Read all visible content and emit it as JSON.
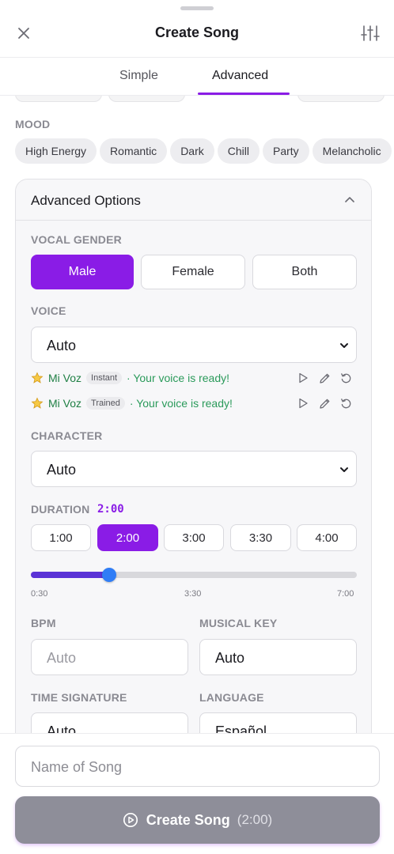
{
  "header": {
    "title": "Create Song"
  },
  "tabs": [
    {
      "label": "Simple",
      "active": false
    },
    {
      "label": "Advanced",
      "active": true
    }
  ],
  "mood": {
    "label": "MOOD",
    "chips": [
      "High Energy",
      "Romantic",
      "Dark",
      "Chill",
      "Party",
      "Melancholic"
    ]
  },
  "advanced": {
    "title": "Advanced Options",
    "vocal_gender": {
      "label": "VOCAL GENDER",
      "options": [
        "Male",
        "Female",
        "Both"
      ],
      "selected": "Male"
    },
    "voice": {
      "label": "VOICE",
      "selected": "Auto",
      "saved": [
        {
          "name": "Mi Voz",
          "badge": "Instant",
          "status": "· Your voice is ready!"
        },
        {
          "name": "Mi Voz",
          "badge": "Trained",
          "status": "· Your voice is ready!"
        }
      ]
    },
    "character": {
      "label": "CHARACTER",
      "selected": "Auto"
    },
    "duration": {
      "label": "DURATION",
      "value": "2:00",
      "options": [
        "1:00",
        "2:00",
        "3:00",
        "3:30",
        "4:00"
      ],
      "selected": "2:00",
      "slider": {
        "min_label": "0:30",
        "mid_label": "3:30",
        "max_label": "7:00",
        "fraction": 0.24
      }
    },
    "bpm": {
      "label": "BPM",
      "placeholder": "Auto"
    },
    "musical_key": {
      "label": "MUSICAL KEY",
      "value": "Auto"
    },
    "time_signature": {
      "label": "TIME SIGNATURE",
      "value": "Auto"
    },
    "language": {
      "label": "LANGUAGE",
      "value": "Español"
    }
  },
  "footer": {
    "name_placeholder": "Name of Song",
    "create_label": "Create Song",
    "create_duration": "(2:00)"
  },
  "colors": {
    "accent": "#8a1ce6",
    "slider_fill": "#5b33d6",
    "slider_thumb": "#2f7df6",
    "voice_name": "#1f7f44",
    "voice_status": "#2a9a5a",
    "create_button": "#8e8e99"
  }
}
